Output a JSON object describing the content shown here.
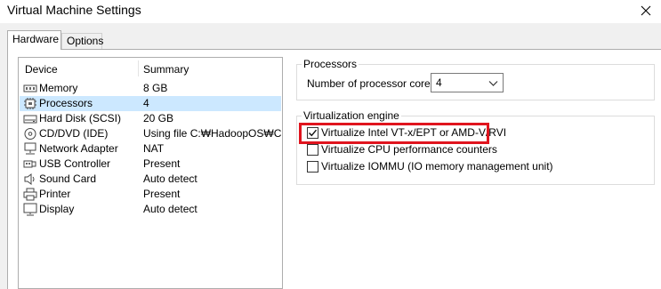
{
  "window": {
    "title": "Virtual Machine Settings"
  },
  "tabs": [
    {
      "label": "Hardware",
      "active": true
    },
    {
      "label": "Options",
      "active": false
    }
  ],
  "device_list": {
    "headers": {
      "device": "Device",
      "summary": "Summary"
    },
    "rows": [
      {
        "name": "Memory",
        "summary": "8 GB",
        "icon": "memory-icon",
        "selected": false
      },
      {
        "name": "Processors",
        "summary": "4",
        "icon": "processor-icon",
        "selected": true
      },
      {
        "name": "Hard Disk (SCSI)",
        "summary": "20 GB",
        "icon": "hard-disk-icon",
        "selected": false
      },
      {
        "name": "CD/DVD (IDE)",
        "summary": "Using file C:₩HadoopOS₩C...",
        "icon": "cd-dvd-icon",
        "selected": false
      },
      {
        "name": "Network Adapter",
        "summary": "NAT",
        "icon": "network-adapter-icon",
        "selected": false
      },
      {
        "name": "USB Controller",
        "summary": "Present",
        "icon": "usb-icon",
        "selected": false
      },
      {
        "name": "Sound Card",
        "summary": "Auto detect",
        "icon": "speaker-icon",
        "selected": false
      },
      {
        "name": "Printer",
        "summary": "Present",
        "icon": "printer-icon",
        "selected": false
      },
      {
        "name": "Display",
        "summary": "Auto detect",
        "icon": "display-icon",
        "selected": false
      }
    ]
  },
  "processors": {
    "group_label": "Processors",
    "cores_label": "Number of processor cores:",
    "cores_value": "4"
  },
  "virtualization": {
    "group_label": "Virtualization engine",
    "options": [
      {
        "label": "Virtualize Intel VT-x/EPT or AMD-V/RVI",
        "checked": true
      },
      {
        "label": "Virtualize CPU performance counters",
        "checked": false
      },
      {
        "label": "Virtualize IOMMU (IO memory management unit)",
        "checked": false
      }
    ]
  },
  "colors": {
    "selection": "#cce8ff",
    "highlight": "#e0141e"
  }
}
